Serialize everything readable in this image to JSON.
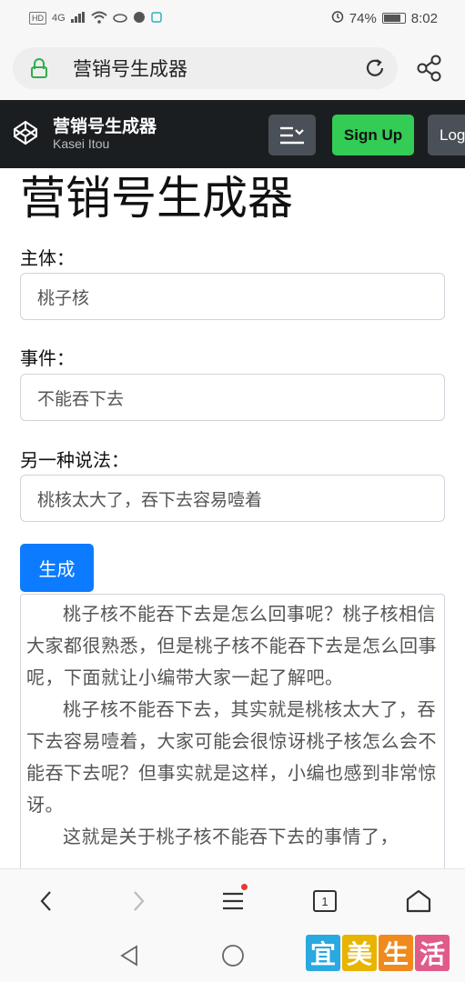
{
  "status_bar": {
    "network": "HD",
    "signal": "4G",
    "battery": "74%",
    "time": "8:02"
  },
  "browser": {
    "url_text": "营销号生成器"
  },
  "navbar": {
    "brand_title": "营销号生成器",
    "brand_subtitle": "Kasei Itou",
    "signup_label": "Sign Up",
    "login_label": "Log"
  },
  "page": {
    "title": "营销号生成器",
    "subject_label": "主体：",
    "subject_value": "桃子核",
    "event_label": "事件：",
    "event_value": "不能吞下去",
    "alt_label": "另一种说法：",
    "alt_value": "桃核太大了，吞下去容易噎着",
    "generate_label": "生成",
    "output": [
      "桃子核不能吞下去是怎么回事呢？桃子核相信大家都很熟悉，但是桃子核不能吞下去是怎么回事呢，下面就让小编带大家一起了解吧。",
      "桃子核不能吞下去，其实就是桃核太大了，吞下去容易噎着，大家可能会很惊讶桃子核怎么会不能吞下去呢？但事实就是这样，小编也感到非常惊讶。",
      "这就是关于桃子核不能吞下去的事情了，"
    ]
  },
  "toolbar": {
    "tab_count": "1"
  },
  "watermark": {
    "chars": [
      "宜",
      "美",
      "生",
      "活"
    ],
    "colors": [
      "#2aa8e0",
      "#e8b400",
      "#f08a1c",
      "#e05a8a"
    ]
  }
}
